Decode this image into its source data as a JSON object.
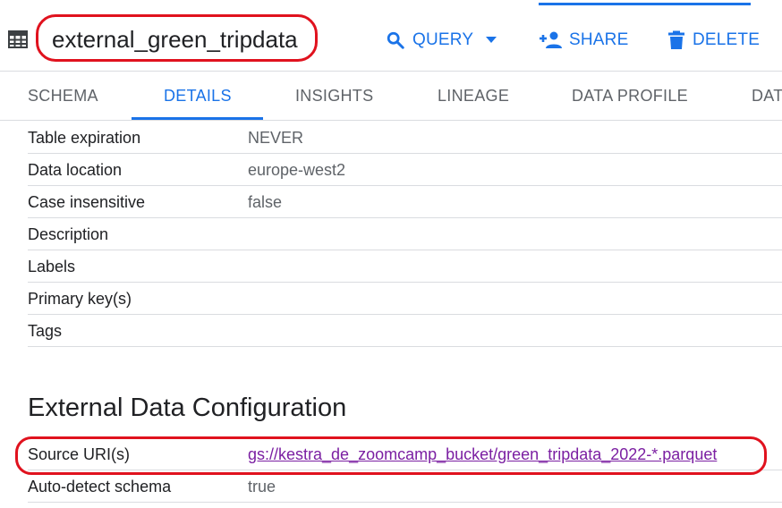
{
  "header": {
    "title": "external_green_tripdata",
    "query_label": "QUERY",
    "share_label": "SHARE",
    "delete_label": "DELETE"
  },
  "tabs": [
    {
      "label": "SCHEMA",
      "active": false
    },
    {
      "label": "DETAILS",
      "active": true
    },
    {
      "label": "INSIGHTS",
      "active": false
    },
    {
      "label": "LINEAGE",
      "active": false
    },
    {
      "label": "DATA PROFILE",
      "active": false
    },
    {
      "label": "DAT",
      "active": false
    }
  ],
  "details": [
    {
      "key": "Table expiration",
      "value": "NEVER"
    },
    {
      "key": "Data location",
      "value": "europe-west2"
    },
    {
      "key": "Case insensitive",
      "value": "false"
    },
    {
      "key": "Description",
      "value": ""
    },
    {
      "key": "Labels",
      "value": ""
    },
    {
      "key": "Primary key(s)",
      "value": ""
    },
    {
      "key": "Tags",
      "value": ""
    }
  ],
  "external_config": {
    "title": "External Data Configuration",
    "rows": [
      {
        "key": "Source URI(s)",
        "value": "gs://kestra_de_zoomcamp_bucket/green_tripdata_2022-*.parquet"
      },
      {
        "key": "Auto-detect schema",
        "value": "true"
      }
    ]
  },
  "colors": {
    "accent": "#1a73e8",
    "annotation": "#e0121e",
    "link": "#7b1fa2"
  },
  "icons": {
    "table": "table-grid-icon",
    "query": "search-icon",
    "query_menu": "caret-down-icon",
    "share": "person-add-icon",
    "delete": "trash-icon"
  }
}
